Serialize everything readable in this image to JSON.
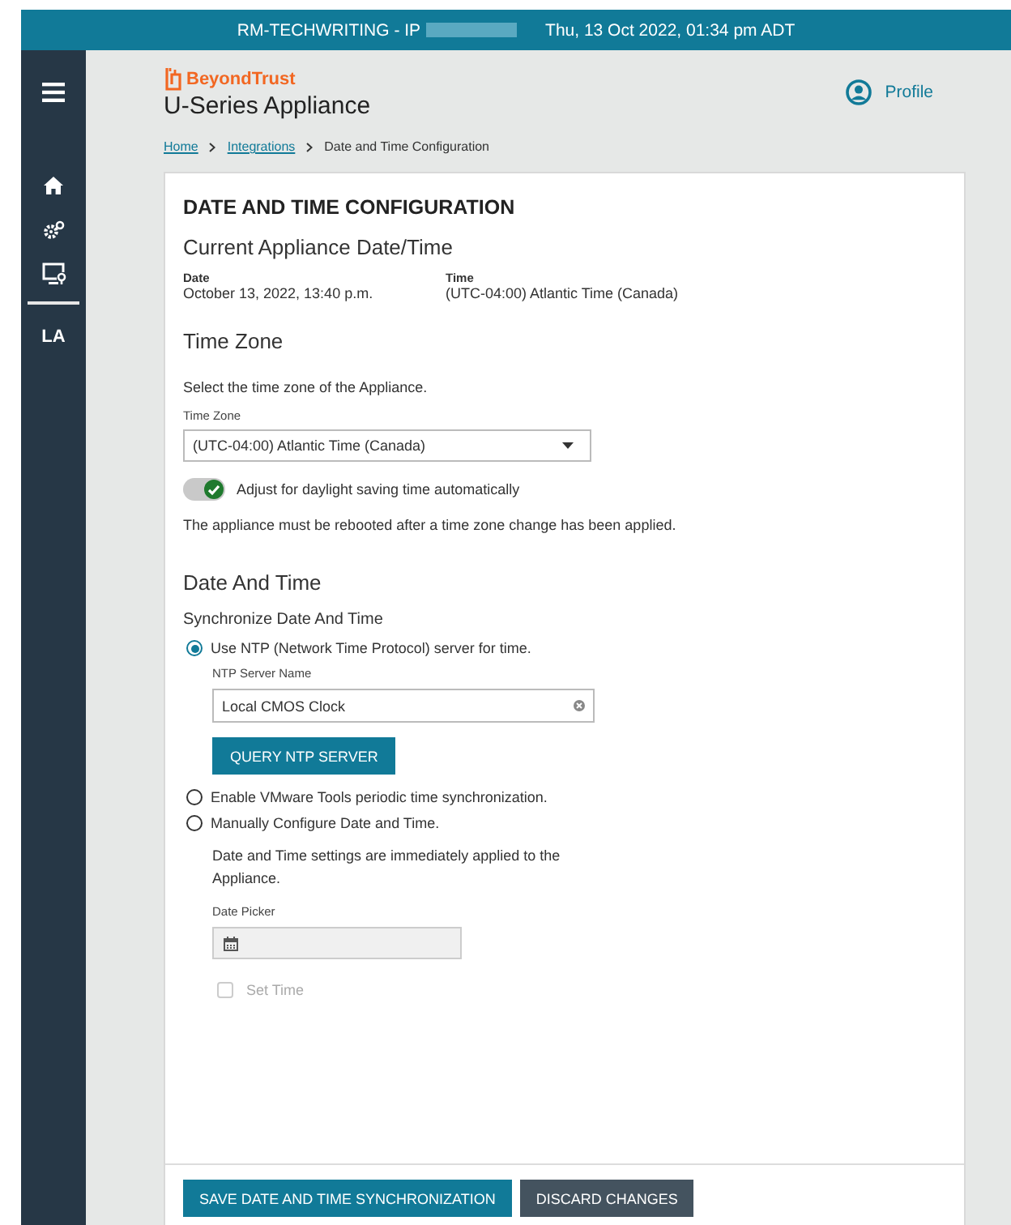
{
  "top_bar": {
    "host": "RM-TECHWRITING - IP",
    "redacted": true,
    "datetime": "Thu, 13 Oct 2022,  01:34 pm ADT"
  },
  "sidebar": {
    "items": [
      {
        "kind": "menu"
      },
      {
        "kind": "home"
      },
      {
        "kind": "gears"
      },
      {
        "kind": "monitor"
      },
      {
        "kind": "divider"
      },
      {
        "kind": "text",
        "label": "LA"
      }
    ]
  },
  "header": {
    "brand": "BeyondTrust",
    "product": "U-Series Appliance",
    "profile": "Profile"
  },
  "breadcrumbs": [
    {
      "label": "Home",
      "link": true
    },
    {
      "label": "Integrations",
      "link": true
    },
    {
      "label": "Date and Time Configuration",
      "link": false
    }
  ],
  "page_title": "DATE AND TIME CONFIGURATION",
  "current": {
    "heading": "Current Appliance Date/Time",
    "fields": [
      {
        "label": "Date",
        "value": "October 13, 2022, 13:40 p.m."
      },
      {
        "label": "Time",
        "value": "(UTC-04:00) Atlantic Time (Canada)"
      }
    ]
  },
  "time_zone": {
    "heading": "Time Zone",
    "description": "Select the time zone of the Appliance.",
    "select_label": "Time Zone",
    "select_value": "(UTC-04:00) Atlantic Time (Canada)",
    "toggle_label": "Adjust for daylight saving time automatically",
    "toggle_on": true,
    "note": "The appliance must be rebooted after a time zone change has been applied."
  },
  "date_and_time": {
    "heading": "Date And Time",
    "subheading": "Synchronize Date And Time",
    "options": [
      {
        "label": "Use NTP (Network Time Protocol) server for time.",
        "selected": true,
        "kind": "ntp"
      },
      {
        "label": "Enable VMware Tools periodic time synchronization.",
        "selected": false,
        "kind": "plain"
      },
      {
        "label": "Manually Configure Date and Time.",
        "selected": false,
        "kind": "manual"
      }
    ],
    "ntp_label": "NTP Server Name",
    "ntp_value": "Local CMOS Clock",
    "query_button": "QUERY NTP SERVER",
    "manual_note": "Date and Time settings are immediately applied to the Appliance.",
    "date_picker_label": "Date Picker",
    "set_time": {
      "label": "Set Time",
      "checked": false,
      "disabled": true
    }
  },
  "buttons": [
    {
      "label": "SAVE DATE AND TIME SYNCHRONIZATION",
      "kind": "primary"
    },
    {
      "label": "DISCARD CHANGES",
      "kind": "secondary"
    }
  ]
}
